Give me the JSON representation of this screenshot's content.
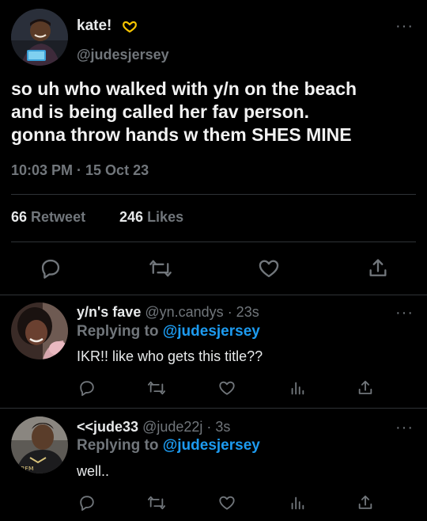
{
  "main_tweet": {
    "display_name": "kate!",
    "handle": "@judesjersey",
    "text_lines": [
      "so uh who walked with y/n on the beach",
      "and is being called her fav person.",
      "gonna throw hands w them SHES MINE"
    ],
    "timestamp": "10:03 PM · 15 Oct 23",
    "retweets_count": "66",
    "retweets_label": "Retweet",
    "likes_count": "246",
    "likes_label": "Likes"
  },
  "replies": [
    {
      "display_name": "y/n's fave",
      "handle": "@yn.candys",
      "time": "· 23s",
      "replying_prefix": "Replying to",
      "replying_handle": "@judesjersey",
      "text": "IKR!! like who gets this title??"
    },
    {
      "display_name": "<<jude33",
      "handle": "@jude22j",
      "time": "· 3s",
      "replying_prefix": "Replying to",
      "replying_handle": "@judesjersey",
      "text": "well.."
    }
  ],
  "more_label": "···",
  "jersey_letters": "ʀꜰᴍ",
  "icons": [
    "reply-icon",
    "retweet-icon",
    "like-icon",
    "share-icon",
    "views-icon",
    "hands-heart-emoji-icon",
    "more-icon"
  ],
  "colors": {
    "background": "#000000",
    "text": "#e7e9ea",
    "secondary": "#71767b",
    "link": "#1d9bf0",
    "divider": "#2f3336"
  }
}
